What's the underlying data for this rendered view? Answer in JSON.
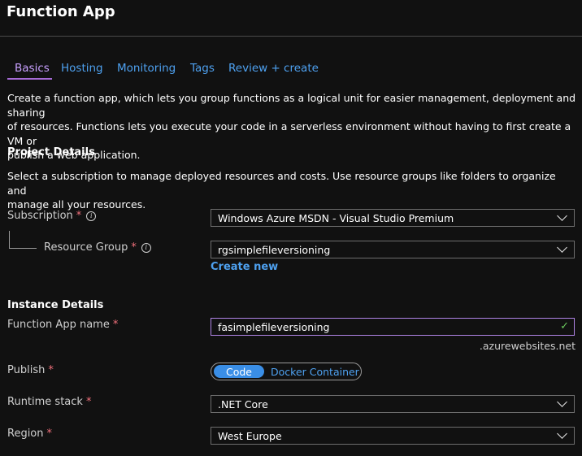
{
  "header": {
    "title": "Function App"
  },
  "tabs": [
    {
      "label": "Basics",
      "active": true
    },
    {
      "label": "Hosting"
    },
    {
      "label": "Monitoring"
    },
    {
      "label": "Tags"
    },
    {
      "label": "Review + create"
    }
  ],
  "intro": {
    "line1": "Create a function app, which lets you group functions as a logical unit for easier management, deployment and sharing",
    "line2": "of resources. Functions lets you execute your code in a serverless environment without having to first create a VM or",
    "line3": "publish a web application."
  },
  "project": {
    "heading": "Project Details",
    "desc_line1": "Select a subscription to manage deployed resources and costs. Use resource groups like folders to organize and",
    "desc_line2": "manage all your resources.",
    "subscription_label": "Subscription",
    "subscription_value": "Windows Azure  MSDN - Visual Studio Premium",
    "resource_group_label": "Resource Group",
    "resource_group_value": "rgsimplefileversioning",
    "create_new": "Create new"
  },
  "instance": {
    "heading": "Instance Details",
    "name_label": "Function App name",
    "name_value": "fasimplefileversioning",
    "name_suffix": ".azurewebsites.net",
    "publish_label": "Publish",
    "publish_options": [
      "Code",
      "Docker Container"
    ],
    "runtime_label": "Runtime stack",
    "runtime_value": ".NET Core",
    "region_label": "Region",
    "region_value": "West Europe"
  },
  "symbols": {
    "required": "*",
    "info": "i",
    "check": "✓"
  },
  "colors": {
    "accent": "#a66bd6",
    "link": "#4ea1f0",
    "required": "#f1707b",
    "valid": "#6ccb5f",
    "toggle_on": "#3a8ee6"
  }
}
